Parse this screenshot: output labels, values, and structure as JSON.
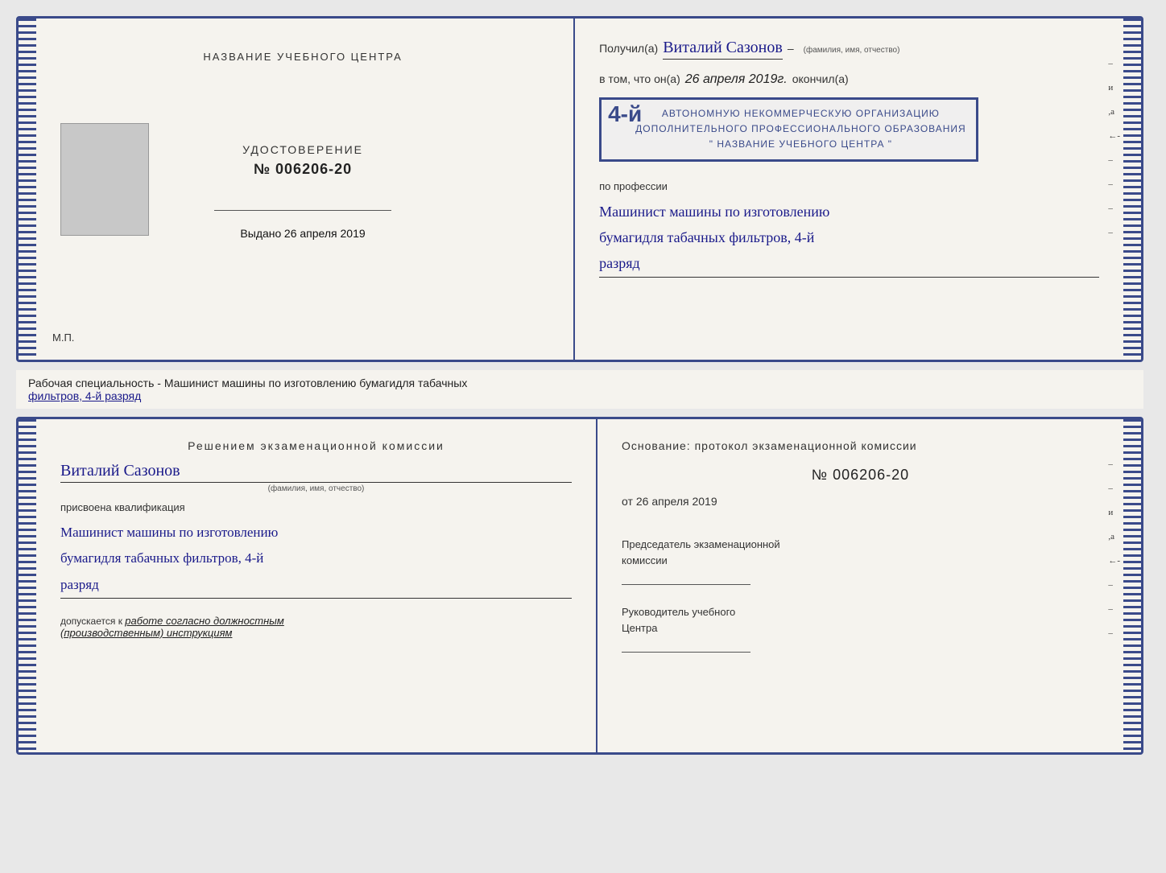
{
  "page": {
    "background": "#e8e8e8"
  },
  "certificate": {
    "left": {
      "title": "НАЗВАНИЕ УЧЕБНОГО ЦЕНТРА",
      "udost_label": "УДОСТОВЕРЕНИЕ",
      "number": "№ 006206-20",
      "vydano_label": "Выдано",
      "vydano_date": "26 апреля 2019",
      "mp_label": "М.П."
    },
    "right": {
      "poluchil_label": "Получил(а)",
      "name": "Виталий Сазонов",
      "name_sublabel": "(фамилия, имя, отчество)",
      "dash": "–",
      "vtom_label": "в том, что он(а)",
      "date": "26 апреля 2019г.",
      "okonchil_label": "окончил(а)",
      "stamp_number": "4-й",
      "stamp_line1": "АВТОНОМНУЮ НЕКОММЕРЧЕСКУЮ ОРГАНИЗАЦИЮ",
      "stamp_line2": "ДОПОЛНИТЕЛЬНОГО ПРОФЕССИОНАЛЬНОГО ОБРАЗОВАНИЯ",
      "stamp_line3": "\" НАЗВАНИЕ УЧЕБНОГО ЦЕНТРА \"",
      "i_label": "и",
      "a_label": ",а",
      "arrow_label": "←-",
      "po_professii_label": "по профессии",
      "profession_line1": "Машинист машины по изготовлению",
      "profession_line2": "бумагидля табачных фильтров, 4-й",
      "profession_line3": "разряд"
    }
  },
  "middle_text": {
    "line1": "Рабочая специальность - Машинист машины по изготовлению бумагидля табачных",
    "line2": "фильтров, 4-й разряд"
  },
  "bottom_document": {
    "left": {
      "title": "Решением  экзаменационной  комиссии",
      "name": "Виталий Сазонов",
      "name_sublabel": "(фамилия, имя, отчество)",
      "prisvoena_label": "присвоена квалификация",
      "profession_line1": "Машинист машины по изготовлению",
      "profession_line2": "бумагидля табачных фильтров, 4-й",
      "profession_line3": "разряд",
      "dopuskaetsya_label": "допускается к",
      "dopusk_text": "работе согласно должностным",
      "dopusk_text2": "(производственным) инструкциям"
    },
    "right": {
      "title": "Основание:  протокол  экзаменационной  комиссии",
      "number": "№  006206-20",
      "ot_label": "от",
      "date": "26 апреля 2019",
      "chairman_line1": "Председатель экзаменационной",
      "chairman_line2": "комиссии",
      "rukovoditel_line1": "Руководитель учебного",
      "rukovoditel_line2": "Центра",
      "dash1": "–",
      "dash2": "–",
      "i_mark": "и",
      "a_mark": ",а",
      "left_arrow": "←-"
    }
  }
}
